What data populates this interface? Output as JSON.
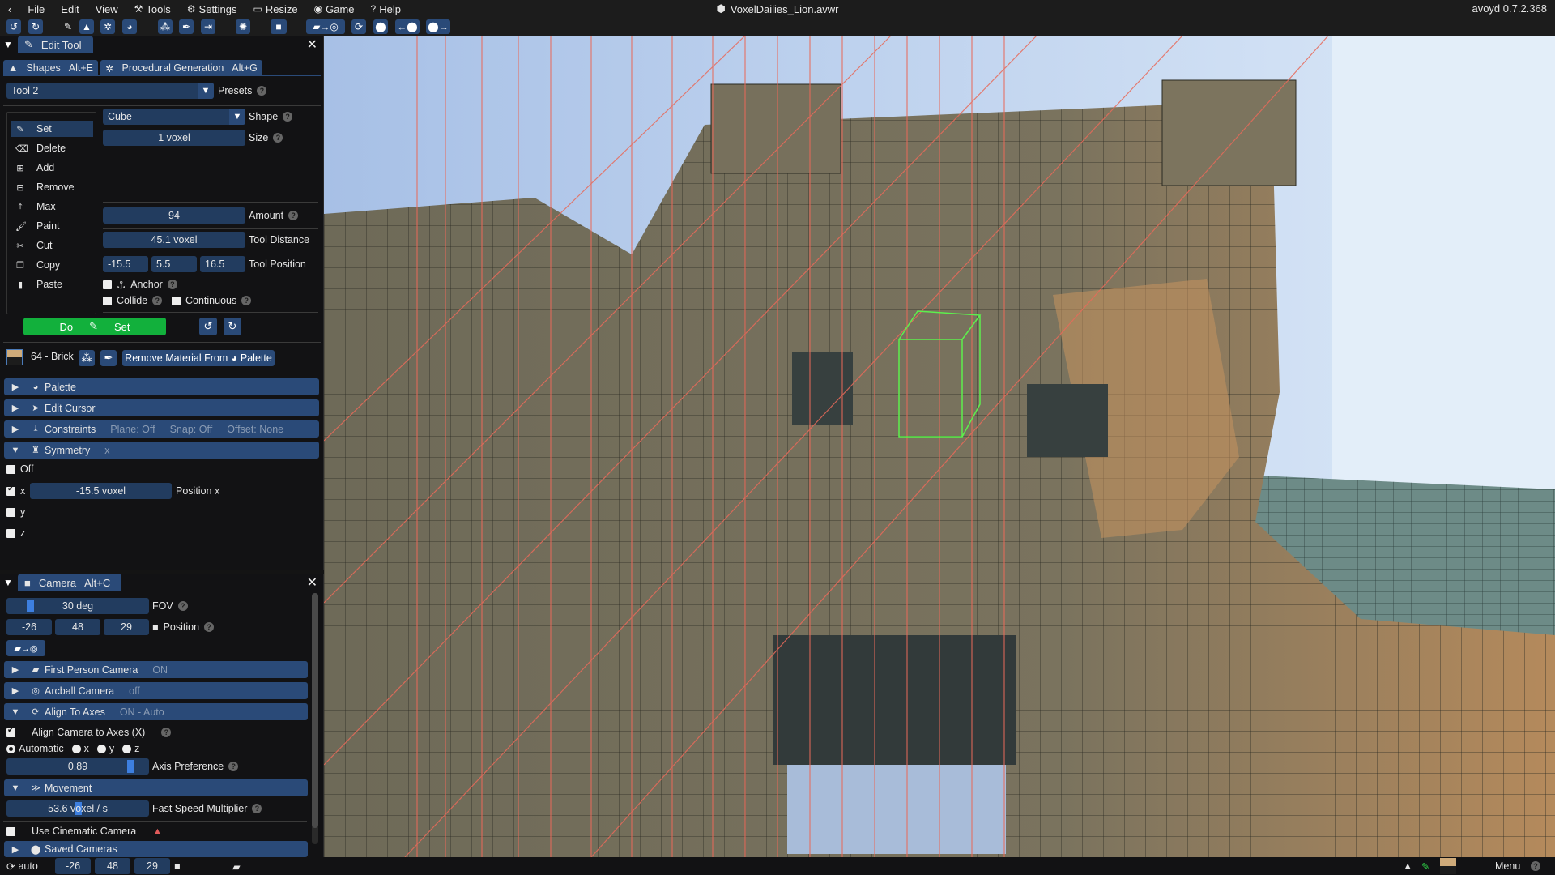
{
  "menubar": {
    "back_icon": "chevron-left-icon",
    "items": [
      {
        "label": "File",
        "icon": ""
      },
      {
        "label": "Edit",
        "icon": ""
      },
      {
        "label": "View",
        "icon": ""
      },
      {
        "label": "Tools",
        "icon": "hammer-icon"
      },
      {
        "label": "Settings",
        "icon": "gear-icon"
      },
      {
        "label": "Resize",
        "icon": "monitor-icon"
      },
      {
        "label": "Game",
        "icon": "gamepad-icon"
      },
      {
        "label": "Help",
        "icon": "question-icon"
      }
    ],
    "title": "VoxelDailies_Lion.avwr",
    "version": "avoyd 0.7.2.368"
  },
  "toolbar": {
    "buttons": [
      "undo",
      "redo",
      "pencil",
      "shapes",
      "procedural",
      "palette",
      "materials",
      "eyedropper",
      "export",
      "lighting",
      "camera",
      "camera-to-arcball",
      "refresh",
      "location",
      "prev-location",
      "next-location"
    ]
  },
  "edit_tool": {
    "title": "Edit Tool",
    "tabs": [
      {
        "label": "Shapes",
        "shortcut": "Alt+E"
      },
      {
        "label": "Procedural Generation",
        "shortcut": "Alt+G"
      }
    ],
    "preset_value": "Tool 2",
    "presets_label": "Presets",
    "modes": [
      {
        "label": "Set",
        "icon": "pencil-icon",
        "active": true
      },
      {
        "label": "Delete",
        "icon": "eraser-icon",
        "active": false
      },
      {
        "label": "Add",
        "icon": "plus-square-icon",
        "active": false
      },
      {
        "label": "Remove",
        "icon": "minus-square-icon",
        "active": false
      },
      {
        "label": "Max",
        "icon": "arrow-up-bar-icon",
        "active": false
      },
      {
        "label": "Paint",
        "icon": "brush-icon",
        "active": false
      },
      {
        "label": "Cut",
        "icon": "scissors-icon",
        "active": false
      },
      {
        "label": "Copy",
        "icon": "copy-icon",
        "active": false
      },
      {
        "label": "Paste",
        "icon": "clipboard-icon",
        "active": false
      }
    ],
    "shape_value": "Cube",
    "shape_label": "Shape",
    "size_value": "1 voxel",
    "size_label": "Size",
    "amount_value": "94",
    "amount_label": "Amount",
    "tool_distance_value": "45.1 voxel",
    "tool_distance_label": "Tool Distance",
    "tool_position": [
      "-15.5",
      "5.5",
      "16.5"
    ],
    "tool_position_label": "Tool Position",
    "anchor_label": "Anchor",
    "anchor_checked": false,
    "collide_label": "Collide",
    "collide_checked": false,
    "continuous_label": "Continuous",
    "continuous_checked": false,
    "do_label": "Do",
    "do_mode_label": "Set",
    "material_label": "64 - Brick",
    "material_color_top": "#cfab7a",
    "remove_material_label": "Remove Material From",
    "remove_material_suffix": "Palette",
    "sections": [
      {
        "label": "Palette",
        "icon": "palette-icon",
        "expanded": false,
        "extra": []
      },
      {
        "label": "Edit Cursor",
        "icon": "cursor-icon",
        "expanded": false,
        "extra": []
      },
      {
        "label": "Constraints",
        "icon": "download-icon",
        "expanded": false,
        "extra": [
          "Plane: Off",
          "Snap: Off",
          "Offset: None"
        ]
      },
      {
        "label": "Symmetry",
        "icon": "rook-icon",
        "expanded": true,
        "extra": [
          "x"
        ]
      }
    ],
    "symmetry": {
      "off_label": "Off",
      "off_checked": false,
      "x_label": "x",
      "x_checked": true,
      "x_value": "-15.5 voxel",
      "x_position_label": "Position x",
      "y_label": "y",
      "y_checked": false,
      "z_label": "z",
      "z_checked": false
    }
  },
  "camera": {
    "title": "Camera",
    "shortcut": "Alt+C",
    "fov_value": "30 deg",
    "fov_label": "FOV",
    "fov_fraction": 0.15,
    "position": [
      "-26",
      "48",
      "29"
    ],
    "position_label": "Position",
    "sections": [
      {
        "label": "First Person Camera",
        "status": "ON",
        "icon": "camera-icon",
        "expanded": false
      },
      {
        "label": "Arcball Camera",
        "status": "off",
        "icon": "globe-icon",
        "expanded": false
      },
      {
        "label": "Align To Axes",
        "status": "ON - Auto",
        "icon": "refresh-icon",
        "expanded": true
      }
    ],
    "align_checkbox_label": "Align Camera to Axes (X)",
    "align_checked": true,
    "align_options": [
      {
        "label": "Automatic",
        "selected": true
      },
      {
        "label": "x",
        "selected": false
      },
      {
        "label": "y",
        "selected": false
      },
      {
        "label": "z",
        "selected": false
      }
    ],
    "axis_preference_value": "0.89",
    "axis_preference_fraction": 0.89,
    "axis_preference_label": "Axis Preference",
    "movement_label": "Movement",
    "fast_speed_value": "53.6 voxel / s",
    "fast_speed_fraction": 0.5,
    "fast_speed_label": "Fast Speed Multiplier",
    "cinematic_label": "Use Cinematic Camera",
    "cinematic_checked": false,
    "saved_cameras_label": "Saved Cameras"
  },
  "statusbar": {
    "mode_label": "auto",
    "position": [
      "-26",
      "48",
      "29"
    ],
    "menu_label": "Menu",
    "material_color": "#cfab7a",
    "accent_green": "#2fd147"
  },
  "colors": {
    "accent_blue": "#2a4a78",
    "field_blue": "#223c5f",
    "do_green": "#12b03c",
    "slider_blue": "#3d7fe0"
  }
}
